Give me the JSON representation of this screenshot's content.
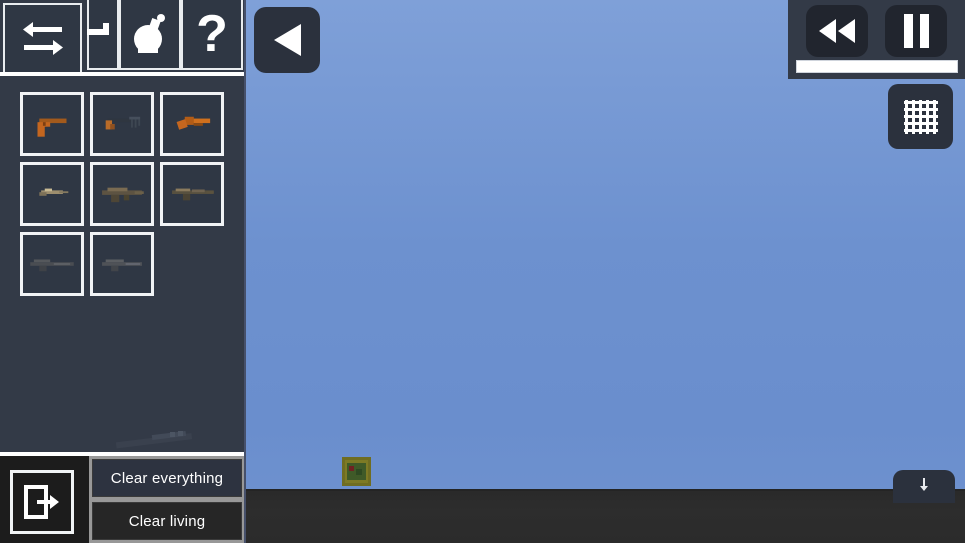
{
  "app": {
    "title": "Weapon Spawner Sandbox",
    "sidebar_bg": "#333a47",
    "accent": "#ffffff",
    "sky_color": "#6d91cf",
    "ground_color": "#2b2b2b"
  },
  "toolbar": {
    "buttons": [
      {
        "name": "swap-tool",
        "icon": "swap-arrows-icon",
        "label": "",
        "selected": true
      },
      {
        "name": "arrow-tool",
        "icon": "arrow-right-icon",
        "label": "",
        "selected": false
      },
      {
        "name": "grenade-tool",
        "icon": "grenade-icon",
        "label": "",
        "selected": false
      },
      {
        "name": "help-tool",
        "icon": "question-mark-icon",
        "label": "?",
        "selected": false
      }
    ]
  },
  "inventory": {
    "items": [
      {
        "name": "pistol",
        "tint": "#c4661f"
      },
      {
        "name": "submachine-gun",
        "tint": "#b96b28"
      },
      {
        "name": "sawed-off-shotgun",
        "tint": "#d0701d"
      },
      {
        "name": "machine-pistol",
        "tint": "#9d8e6e"
      },
      {
        "name": "assault-rifle",
        "tint": "#7a6b52"
      },
      {
        "name": "battle-rifle",
        "tint": "#6f6350"
      },
      {
        "name": "sniper-rifle",
        "tint": "#55585c"
      },
      {
        "name": "carbine",
        "tint": "#5b5e62"
      }
    ],
    "drag_item": {
      "name": "dragged-rifle",
      "tint": "#3c4350"
    }
  },
  "scene_controls": {
    "back_label": "",
    "back_icon": "triangle-left-icon",
    "rewind_icon": "rewind-icon",
    "pause_icon": "pause-icon",
    "grid_icon": "grid-icon",
    "timeline_value": "",
    "bottom_tray_icon": "anchor-down-icon"
  },
  "bottom_bar": {
    "exit_icon": "exit-door-icon",
    "clear_everything_label": "Clear everything",
    "clear_living_label": "Clear living"
  },
  "scene": {
    "entity_name": "spawned-crate-entity"
  }
}
